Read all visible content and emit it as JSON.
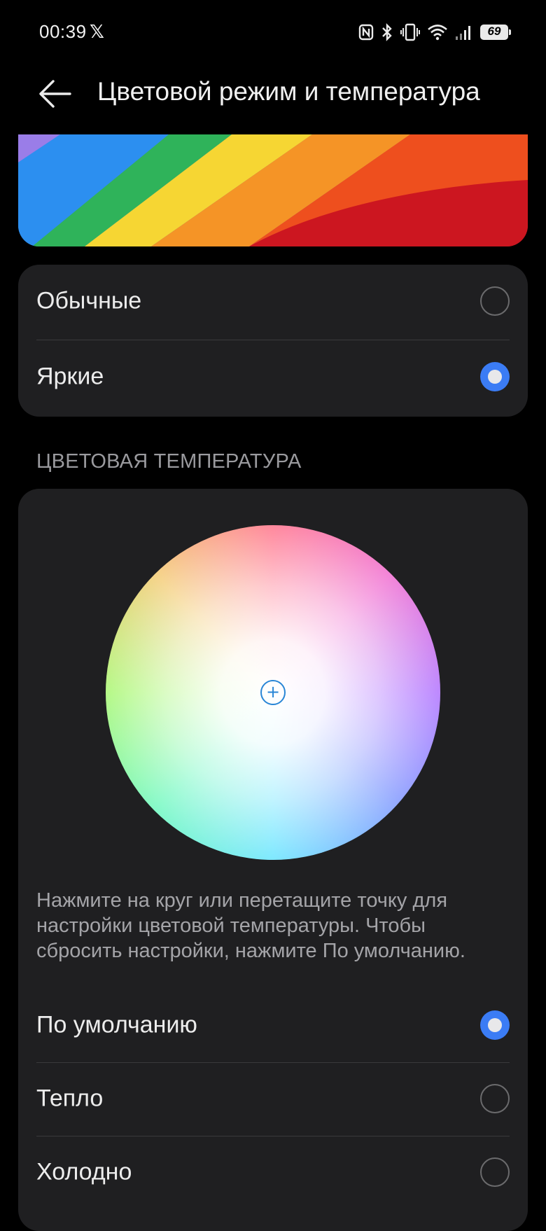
{
  "status_bar": {
    "time": "00:39",
    "battery": "69"
  },
  "header": {
    "title": "Цветовой режим и температура"
  },
  "color_mode": {
    "options": [
      {
        "label": "Обычные",
        "selected": false
      },
      {
        "label": "Яркие",
        "selected": true
      }
    ]
  },
  "color_temperature": {
    "section_title": "ЦВЕТОВАЯ ТЕМПЕРАТУРА",
    "hint": "Нажмите на круг или перетащите точку для настройки цветовой температуры. Чтобы сбросить настройки, нажмите По умолчанию.",
    "options": [
      {
        "label": "По умолчанию",
        "selected": true
      },
      {
        "label": "Тепло",
        "selected": false
      },
      {
        "label": "Холодно",
        "selected": false
      }
    ]
  },
  "colors": {
    "accent": "#3b7cf5",
    "card": "#1f1f21"
  }
}
